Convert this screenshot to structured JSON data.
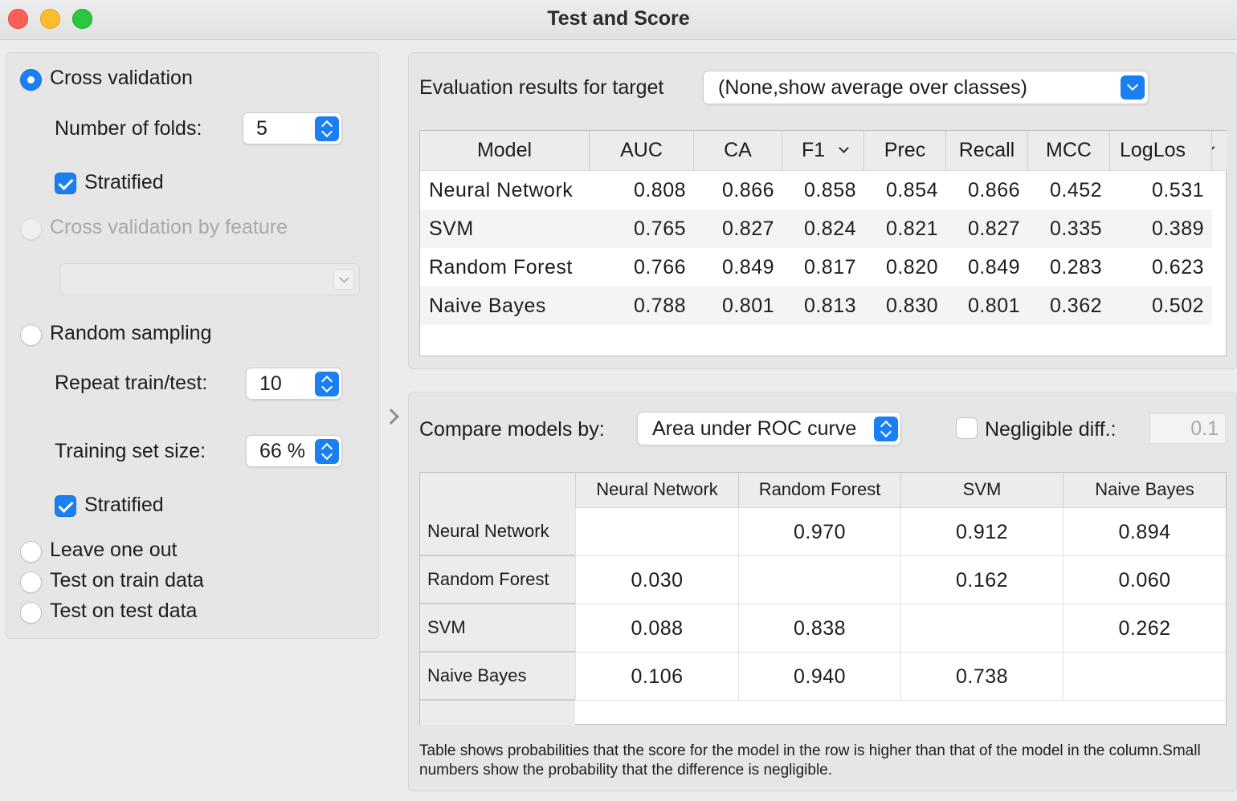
{
  "window": {
    "title": "Test and Score"
  },
  "sampling": {
    "cross_validation": {
      "label": "Cross validation",
      "selected": true
    },
    "folds_label": "Number of folds:",
    "folds_value": "5",
    "stratified_label": "Stratified",
    "cv_by_feature": {
      "label": "Cross validation by feature",
      "enabled": false
    },
    "random_sampling": {
      "label": "Random sampling",
      "selected": false
    },
    "repeat_label": "Repeat train/test:",
    "repeat_value": "10",
    "train_size_label": "Training set size:",
    "train_size_value": "66 %",
    "stratified2_label": "Stratified",
    "leave_one_out": "Leave one out",
    "test_on_train": "Test on train data",
    "test_on_test": "Test on test data"
  },
  "evaluation": {
    "target_label": "Evaluation results for target",
    "target_value": "(None,show average over classes)",
    "columns": [
      "Model",
      "AUC",
      "CA",
      "F1",
      "Prec",
      "Recall",
      "MCC",
      "LogLos"
    ],
    "rows": [
      {
        "model": "Neural Network",
        "values": [
          "0.808",
          "0.866",
          "0.858",
          "0.854",
          "0.866",
          "0.452",
          "0.531"
        ]
      },
      {
        "model": "SVM",
        "values": [
          "0.765",
          "0.827",
          "0.824",
          "0.821",
          "0.827",
          "0.335",
          "0.389"
        ]
      },
      {
        "model": "Random Forest",
        "values": [
          "0.766",
          "0.849",
          "0.817",
          "0.820",
          "0.849",
          "0.283",
          "0.623"
        ]
      },
      {
        "model": "Naive Bayes",
        "values": [
          "0.788",
          "0.801",
          "0.813",
          "0.830",
          "0.801",
          "0.362",
          "0.502"
        ]
      }
    ]
  },
  "compare": {
    "label": "Compare models by:",
    "value": "Area under ROC curve",
    "negligible_label": "Negligible diff.:",
    "negligible_value": "0.1",
    "columns": [
      "Neural Network",
      "Random Forest",
      "SVM",
      "Naive Bayes"
    ],
    "rows": [
      {
        "model": "Neural Network",
        "values": [
          "",
          "0.970",
          "0.912",
          "0.894"
        ]
      },
      {
        "model": "Random Forest",
        "values": [
          "0.030",
          "",
          "0.162",
          "0.060"
        ]
      },
      {
        "model": "SVM",
        "values": [
          "0.088",
          "0.838",
          "",
          "0.262"
        ]
      },
      {
        "model": "Naive Bayes",
        "values": [
          "0.106",
          "0.940",
          "0.738",
          ""
        ]
      }
    ],
    "note": "Table shows probabilities that the score for the model in the row is higher than that of the model in the column.Small numbers show the probability that the difference is negligible."
  },
  "colors": {
    "accent": "#1a7ff2",
    "close": "#fe5f57",
    "minimize": "#febc2e",
    "maximize": "#28c840"
  }
}
